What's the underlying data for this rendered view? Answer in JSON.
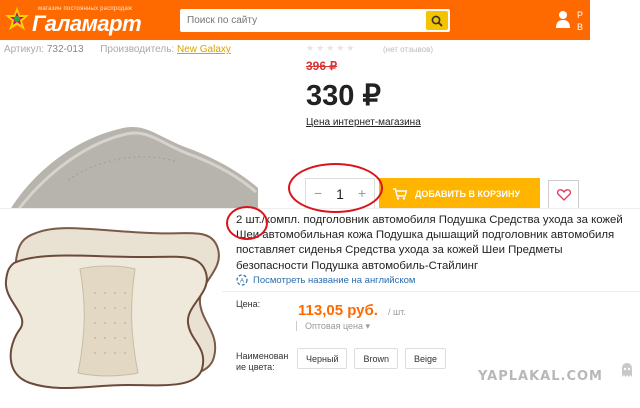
{
  "header": {
    "logo_slogan": "магазин постоянных распродаж",
    "logo_text": "Галамарт",
    "search_placeholder": "Поиск по сайту",
    "user_line1": "Р",
    "user_line2": "В"
  },
  "product": {
    "article_label": "Артикул:",
    "article_value": "732-013",
    "manufacturer_label": "Производитель:",
    "manufacturer_value": "New Galaxy",
    "stars": "★★★★★",
    "reviews": "(нет отзывов)",
    "old_price": "396 ₽",
    "price": "330 ₽",
    "price_label": "Цена интернет-магазина",
    "quantity": "1",
    "qty_minus": "−",
    "qty_plus": "+",
    "add_to_cart": "ДОБАВИТЬ В КОРЗИНУ"
  },
  "listing": {
    "title": "2 шт./компл. подголовник автомобиля Подушка Средства ухода за кожей Шеи автомобильная кожа Подушка дышащий подголовник автомобиля поставляет сиденья Средства ухода за кожей Шеи Предметы безопасности Подушка автомобиль-Стайлинг",
    "translate_link": "Посмотреть название на английском",
    "price_label": "Цена:",
    "price": "113,05 руб.",
    "unit": "/ шт.",
    "wholesale": "Оптовая цена ▾",
    "color_label_1": "Наименован",
    "color_label_2": "ие цвета:",
    "colors": [
      "Черный",
      "Brown",
      "Beige"
    ]
  },
  "watermark": "YAPLAKAL.COM",
  "colors": {
    "header_orange": "#ff6a00",
    "button_yellow": "#ffb400",
    "annotation_red": "#d8141c",
    "price_orange": "#ff6a00"
  }
}
